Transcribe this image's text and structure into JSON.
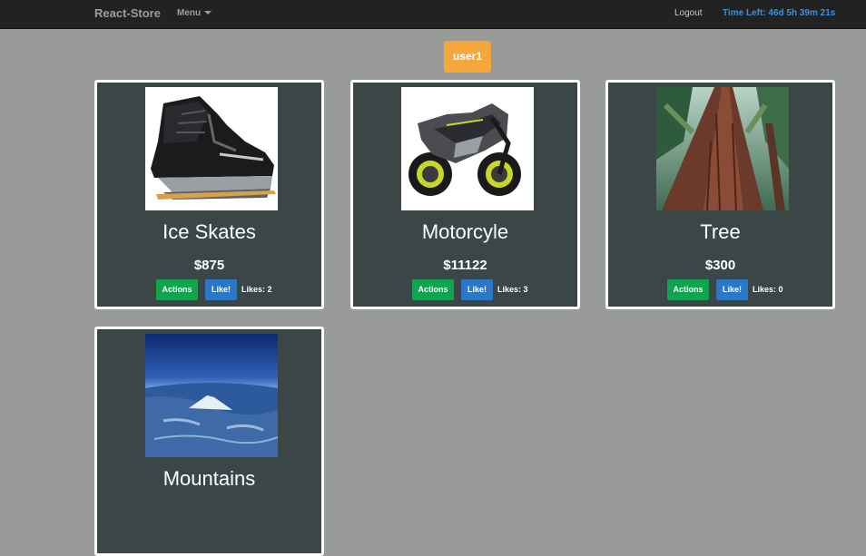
{
  "navbar": {
    "brand": "React-Store",
    "menu_label": "Menu",
    "logout_label": "Logout",
    "time_left": "Time Left: 46d 5h 39m 21s"
  },
  "user": {
    "name": "user1"
  },
  "products": [
    {
      "title": "Ice Skates",
      "price": "$875",
      "actions_label": "Actions",
      "like_label": "Like!",
      "likes": "Likes: 2",
      "icon": "ice-skate-image"
    },
    {
      "title": "Motorcyle",
      "price": "$11122",
      "actions_label": "Actions",
      "like_label": "Like!",
      "likes": "Likes: 3",
      "icon": "motorcycle-image"
    },
    {
      "title": "Tree",
      "price": "$300",
      "actions_label": "Actions",
      "like_label": "Like!",
      "likes": "Likes: 0",
      "icon": "tree-image"
    },
    {
      "title": "Mountains",
      "icon": "mountains-image"
    }
  ],
  "colors": {
    "navbar_bg": "#222222",
    "page_bg": "#999b98",
    "card_bg": "#3b4647",
    "user_badge": "#f6a73b",
    "actions_button": "#10a450",
    "like_button": "#2c78c8",
    "time_left_text": "#3f8fdb"
  }
}
